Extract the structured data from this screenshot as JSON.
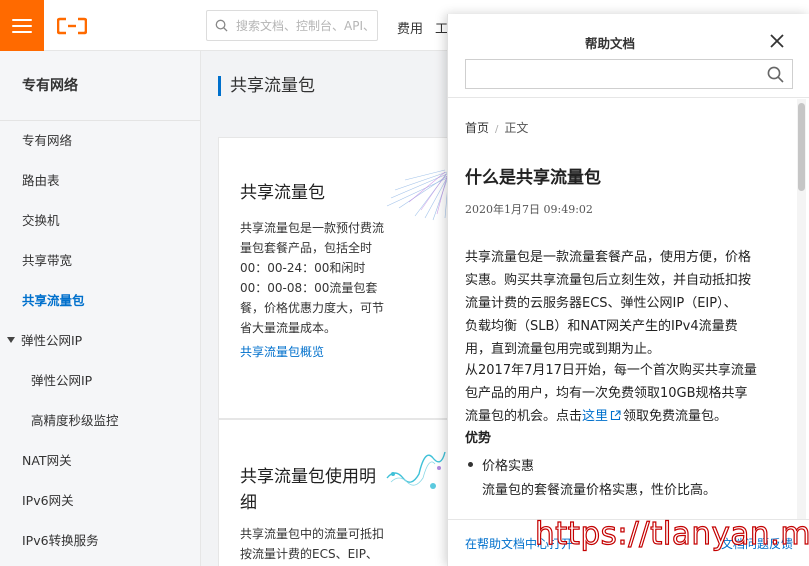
{
  "topbar": {
    "search_placeholder": "搜索文档、控制台、API、",
    "links": [
      "费用",
      "工"
    ]
  },
  "colors": {
    "brand": "#ff6a00",
    "link": "#0070cc",
    "watermark": "#c40000"
  },
  "sidebar": {
    "title": "专有网络",
    "items": [
      {
        "label": "专有网络"
      },
      {
        "label": "路由表"
      },
      {
        "label": "交换机"
      },
      {
        "label": "共享带宽"
      },
      {
        "label": "共享流量包",
        "active": true
      },
      {
        "label": "弹性公网IP",
        "expanded": true
      },
      {
        "label": "弹性公网IP"
      },
      {
        "label": "高精度秒级监控"
      },
      {
        "label": "NAT网关"
      },
      {
        "label": "IPv6网关"
      },
      {
        "label": "IPv6转换服务"
      }
    ]
  },
  "main": {
    "page_title": "共享流量包",
    "cards": [
      {
        "title": "共享流量包",
        "desc": [
          "共享流量包是一款预付费流",
          "量包套餐产品，包括全时",
          "00：00-24：00和闲时",
          "00：00-08：00流量包套",
          "餐，价格优惠力度大，可节",
          "省大量流量成本。"
        ],
        "link": "共享流量包概览"
      },
      {
        "title": [
          "共享流量包使用明",
          "细"
        ],
        "desc": [
          "共享流量包中的流量可抵扣",
          "按流量计费的ECS、EIP、"
        ]
      }
    ]
  },
  "help": {
    "title": "帮助文档",
    "search_value": "",
    "breadcrumb": {
      "home": "首页",
      "current": "正文"
    },
    "doc_title": "什么是共享流量包",
    "doc_date": "2020年1月7日 09:49:02",
    "para1": [
      "共享流量包是一款流量套餐产品，使用方便，价格",
      "实惠。购买共享流量包后立刻生效，并自动抵扣按",
      "流量计费的云服务器ECS、弹性公网IP（EIP）、",
      "负载均衡（SLB）和NAT网关产生的IPv4流量费",
      "用，直到流量包用完或到期为止。"
    ],
    "para2": {
      "lines": [
        "从2017年7月17日开始，每一个首次购买共享流量",
        "包产品的用户，均有一次免费领取10GB规格共享"
      ],
      "last_before": "流量包的机会。点击",
      "link": "这里",
      "last_after": "领取免费流量包。"
    },
    "section_heading": "优势",
    "bullet_title": "价格实惠",
    "bullet_desc": "流量包的套餐流量价格实惠，性价比高。",
    "footer_left": "在帮助文档中心打开",
    "footer_right": "文档问题反馈"
  },
  "watermark": "https://tlanyan.me"
}
